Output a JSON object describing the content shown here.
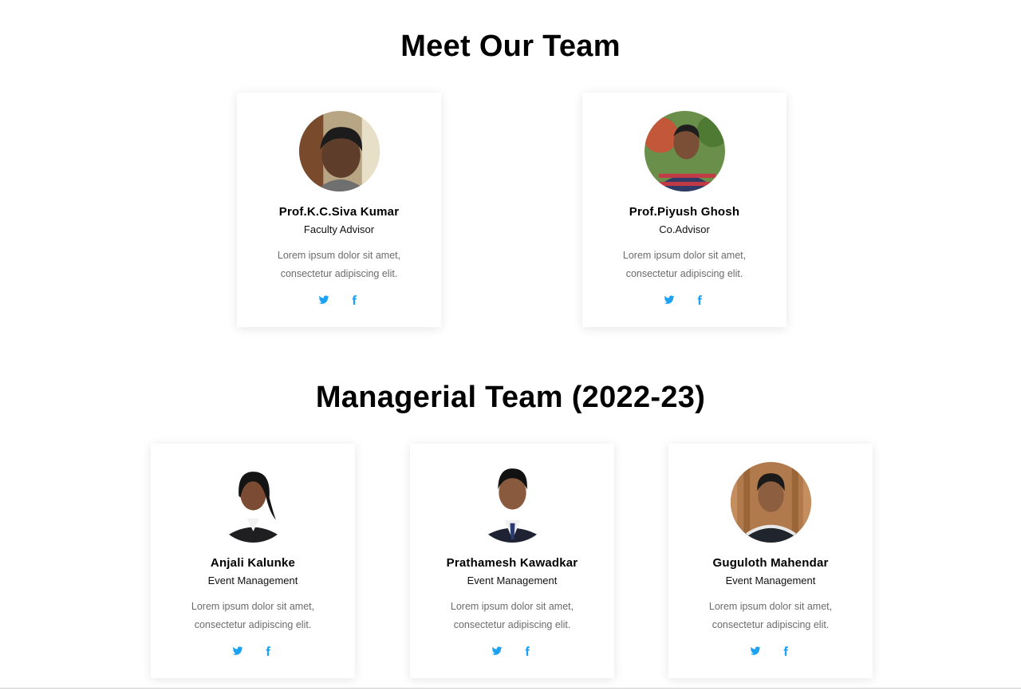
{
  "sections": {
    "team_title": "Meet Our Team",
    "managerial_title": "Managerial Team (2022-23)"
  },
  "faculty": [
    {
      "name": "Prof.K.C.Siva Kumar",
      "role": "Faculty Advisor",
      "desc_line1": "Lorem ipsum dolor sit amet,",
      "desc_line2": "consectetur adipiscing elit.",
      "twitter_icon": "twitter-icon",
      "facebook_icon": "facebook-icon"
    },
    {
      "name": "Prof.Piyush Ghosh",
      "role": "Co.Advisor",
      "desc_line1": "Lorem ipsum dolor sit amet,",
      "desc_line2": "consectetur adipiscing elit.",
      "twitter_icon": "twitter-icon",
      "facebook_icon": "facebook-icon"
    }
  ],
  "managers": [
    {
      "name": "Anjali Kalunke",
      "role": "Event Management",
      "desc_line1": "Lorem ipsum dolor sit amet,",
      "desc_line2": "consectetur adipiscing elit.",
      "twitter_icon": "twitter-icon",
      "facebook_icon": "facebook-icon"
    },
    {
      "name": "Prathamesh Kawadkar",
      "role": "Event Management",
      "desc_line1": "Lorem ipsum dolor sit amet,",
      "desc_line2": "consectetur adipiscing elit.",
      "twitter_icon": "twitter-icon",
      "facebook_icon": "facebook-icon"
    },
    {
      "name": "Guguloth Mahendar",
      "role": "Event Management",
      "desc_line1": "Lorem ipsum dolor sit amet,",
      "desc_line2": "consectetur adipiscing elit.",
      "twitter_icon": "twitter-icon",
      "facebook_icon": "facebook-icon"
    }
  ],
  "colors": {
    "social_icon": "#1da1f2",
    "description_text": "#6b6b6b",
    "card_background": "#ffffff"
  }
}
